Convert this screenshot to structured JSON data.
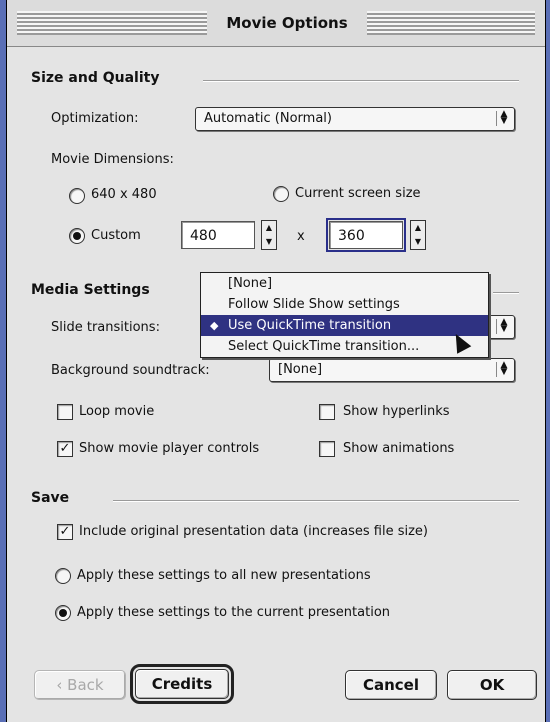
{
  "window": {
    "title": "Movie Options"
  },
  "size_quality": {
    "header": "Size and Quality",
    "optimization_label": "Optimization:",
    "optimization_value": "Automatic (Normal)",
    "dimensions_label": "Movie Dimensions:",
    "opt_640": "640 x 480",
    "opt_screen": "Current screen size",
    "opt_custom": "Custom",
    "width_value": "480",
    "times": "x",
    "height_value": "360"
  },
  "media": {
    "header": "Media Settings",
    "transitions_label": "Slide transitions:",
    "soundtrack_label": "Background soundtrack:",
    "soundtrack_value": "[None]",
    "loop_movie": "Loop movie",
    "show_hyperlinks": "Show hyperlinks",
    "show_controls": "Show movie player controls",
    "show_animations": "Show animations",
    "menu_items": [
      "[None]",
      "Follow Slide Show settings",
      "Use QuickTime transition",
      "Select QuickTime transition..."
    ],
    "selected_index": 2
  },
  "save": {
    "header": "Save",
    "include_data": "Include original presentation data (increases file size)",
    "apply_new": "Apply these settings to all new presentations",
    "apply_current": "Apply these settings to the current presentation"
  },
  "buttons": {
    "back": "‹ Back",
    "credits": "Credits",
    "cancel": "Cancel",
    "ok": "OK"
  }
}
